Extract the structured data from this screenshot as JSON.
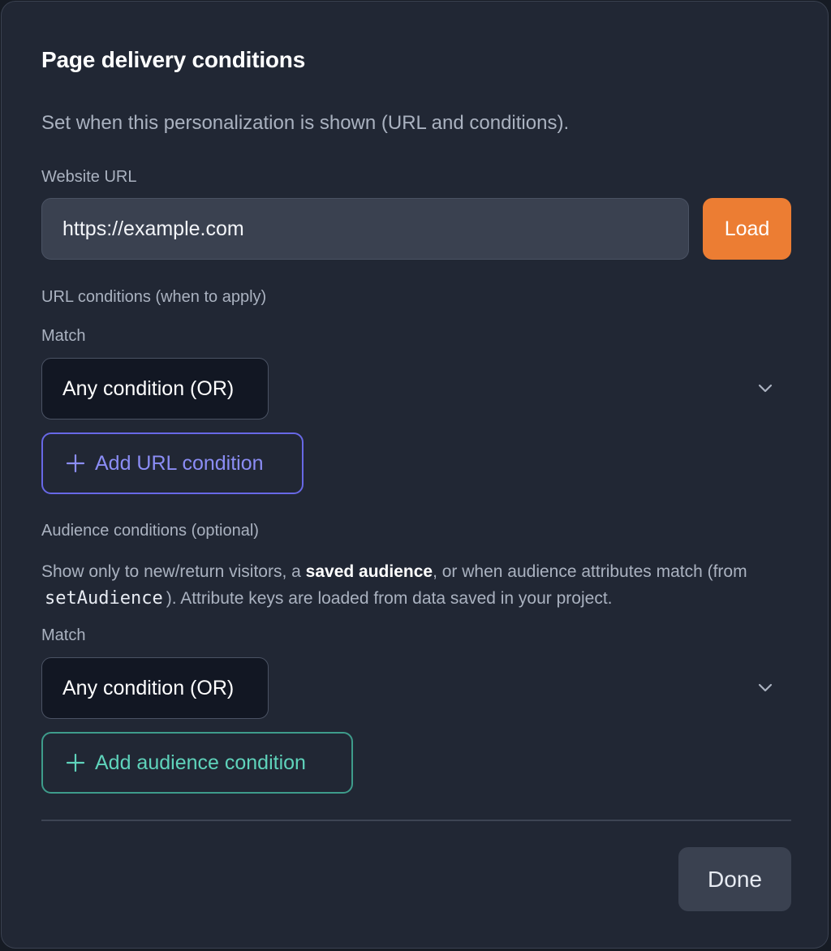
{
  "dialog": {
    "title": "Page delivery conditions",
    "subtitle": "Set when this personalization is shown (URL and conditions)."
  },
  "website": {
    "label": "Website URL",
    "url_value": "https://example.com",
    "load_label": "Load"
  },
  "url_conditions": {
    "heading": "URL conditions (when to apply)",
    "match_label": "Match",
    "match_selected": "Any condition (OR)",
    "add_label": "Add URL condition"
  },
  "audience_conditions": {
    "heading": "Audience conditions (optional)",
    "desc_part1": "Show only to new/return visitors, a ",
    "desc_bold": "saved audience",
    "desc_part2": ", or when audience attributes match (from ",
    "desc_code": "setAudience",
    "desc_part3": "). Attribute keys are loaded from data saved in your project.",
    "match_label": "Match",
    "match_selected": "Any condition (OR)",
    "add_label": "Add audience condition"
  },
  "footer": {
    "done_label": "Done"
  },
  "icons": {
    "chevron": "chevron-down-icon",
    "plus": "plus-icon"
  },
  "colors": {
    "background": "#212734",
    "accent_orange": "#ec7d33",
    "url_add_accent": "#8b8df5",
    "audience_add_accent": "#5fd3bb"
  }
}
